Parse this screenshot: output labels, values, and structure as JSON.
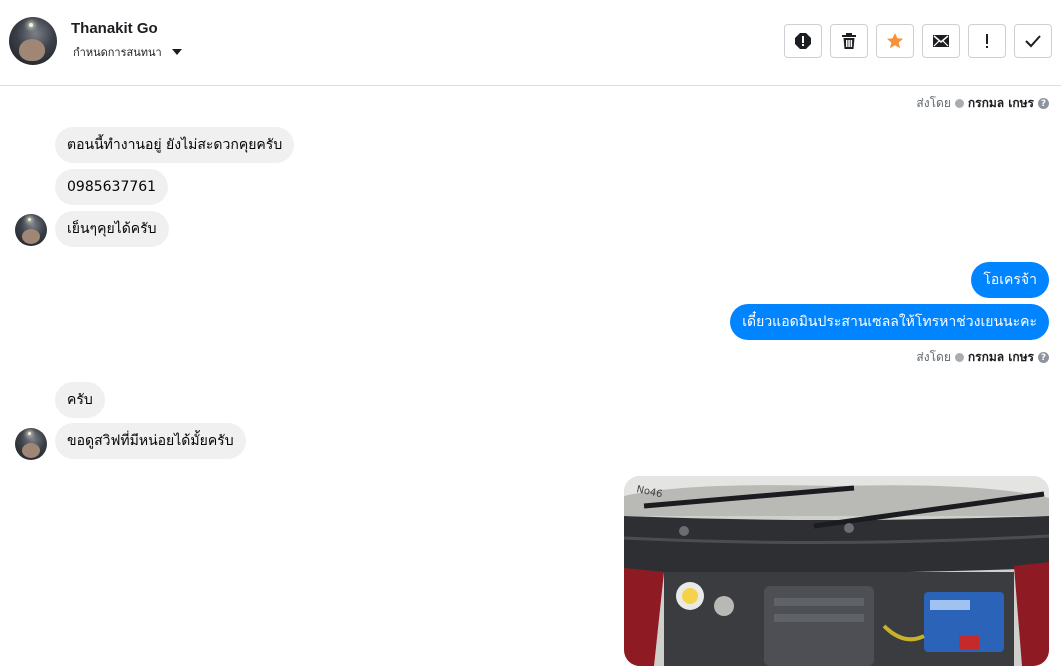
{
  "header": {
    "contact_name": "Thanakit Go",
    "assign_label": "กำหนดการสนทนา"
  },
  "toolbar": {
    "buttons": [
      {
        "name": "report-spam-icon"
      },
      {
        "name": "trash-icon"
      },
      {
        "name": "star-icon",
        "accent": "#f7923b"
      },
      {
        "name": "mail-icon"
      },
      {
        "name": "exclamation-icon"
      },
      {
        "name": "checkmark-icon"
      }
    ]
  },
  "sent_by": {
    "prefix": "ส่งโดย",
    "agent": "กรกมล เกษร"
  },
  "messages": {
    "in_1": "ตอนนี้ทำงานอยู่ ยังไม่สะดวกคุยครับ",
    "in_2": "0985637761",
    "in_3": "เย็นๆคุยได้ครับ",
    "out_1": "โอเครจ้า",
    "out_2": "เดี๋ยวแอดมินประสานเซลลให้โทรหาช่วงเยนนะคะ",
    "in_4": "ครับ",
    "in_5": "ขอดูสวิฟที่มีหน่อยได้มั้ยครับ"
  },
  "colors": {
    "outgoing_bubble": "#0084ff",
    "incoming_bubble": "#f0f0f0"
  }
}
